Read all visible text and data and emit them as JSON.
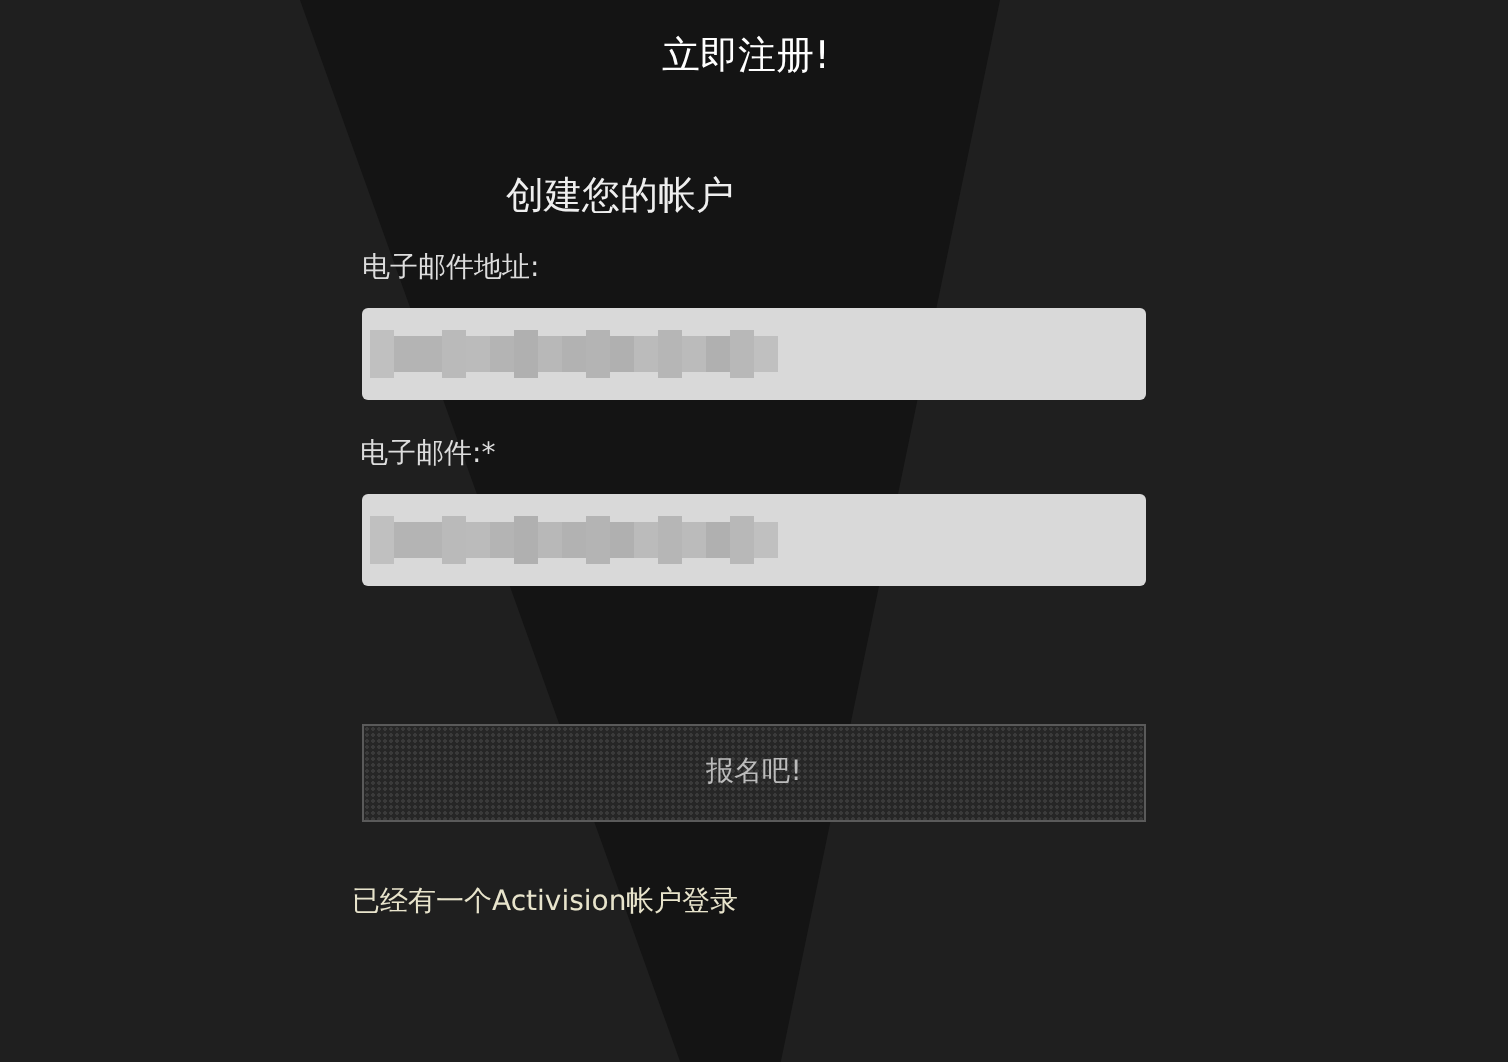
{
  "title": "立即注册!",
  "subtitle": "创建您的帐户",
  "fields": [
    {
      "label": "电子邮件地址:"
    },
    {
      "label": "电子邮件:*"
    }
  ],
  "submit_button": "报名吧!",
  "login_link": "已经有一个Activision帐户登录"
}
